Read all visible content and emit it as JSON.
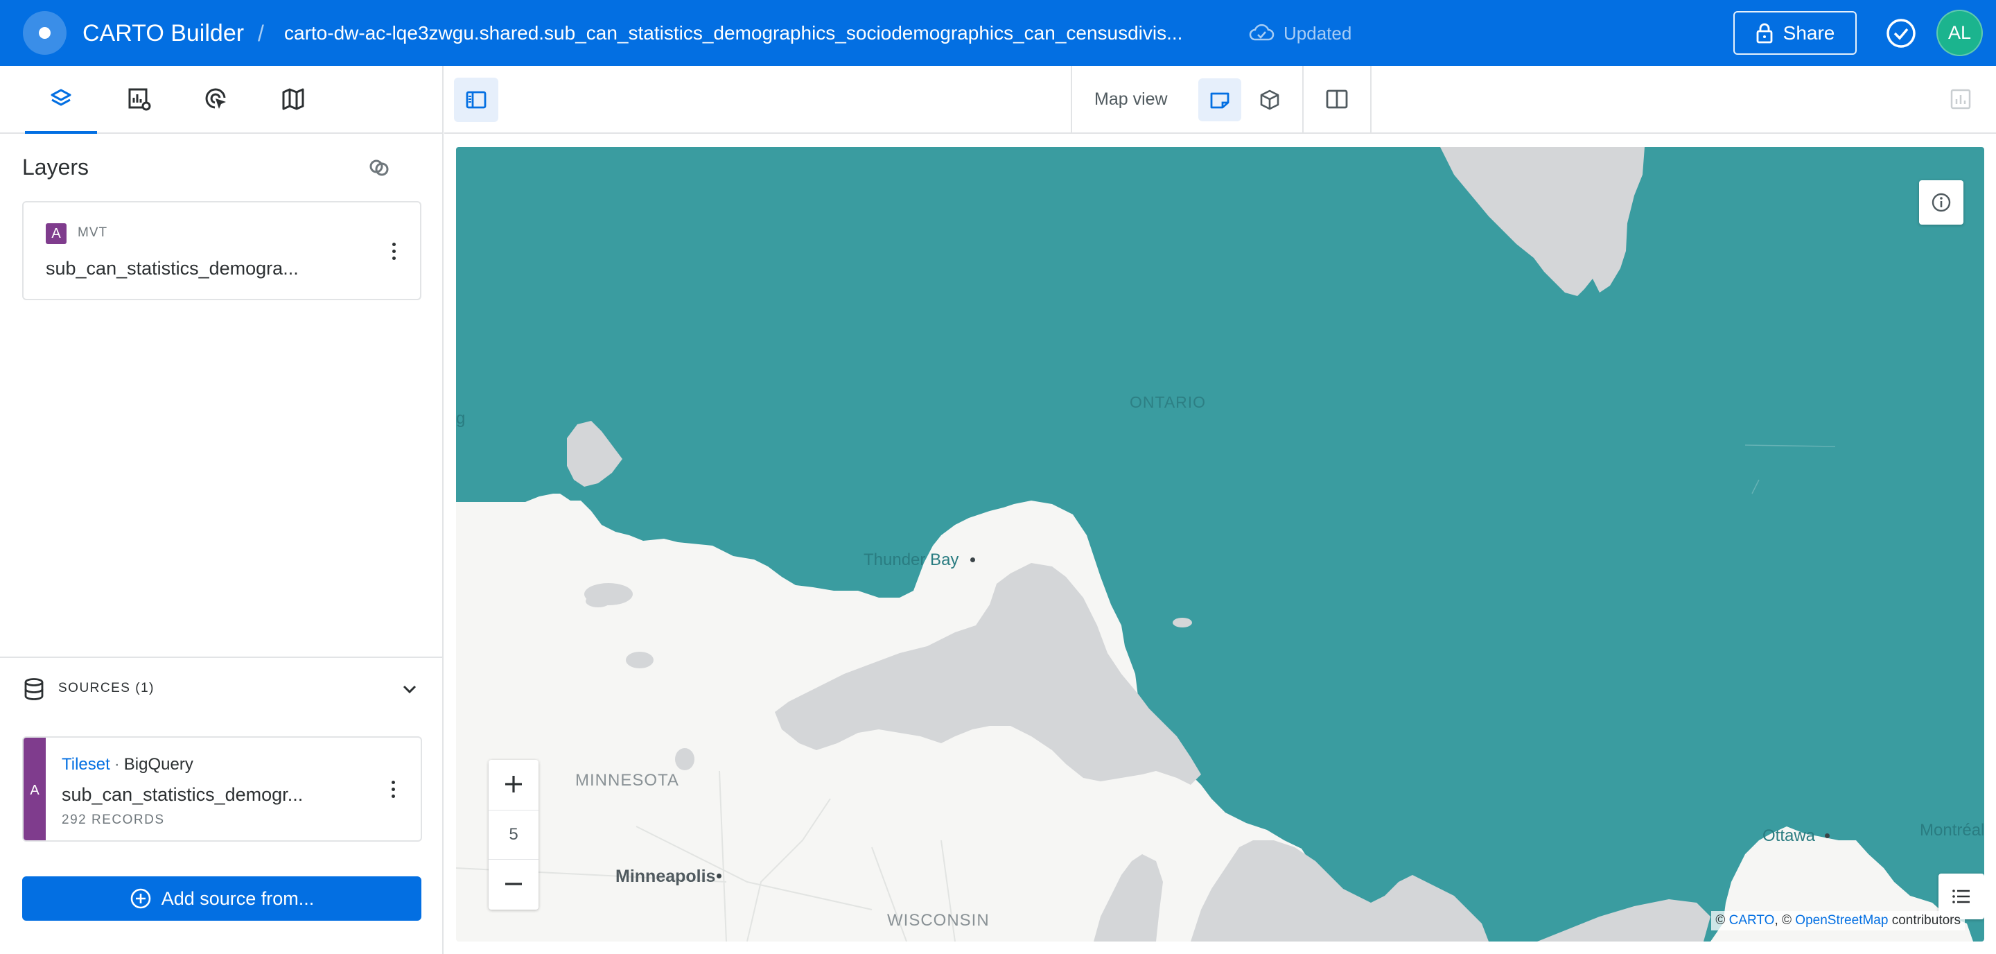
{
  "header": {
    "app_name": "CARTO Builder",
    "separator": "/",
    "map_title": "carto-dw-ac-lqe3zwgu.shared.sub_can_statistics_demographics_sociodemographics_can_censusdivis...",
    "status": "Updated",
    "share_label": "Share",
    "avatar_initials": "AL",
    "accent_color": "#036fe2"
  },
  "left_panel": {
    "tabs": [
      {
        "icon": "layers-icon",
        "active": true
      },
      {
        "icon": "widgets-settings-icon",
        "active": false
      },
      {
        "icon": "interactions-icon",
        "active": false
      },
      {
        "icon": "basemap-icon",
        "active": false
      }
    ],
    "layers_title": "Layers",
    "layer": {
      "badge": "A",
      "type": "MVT",
      "name": "sub_can_statistics_demogra...",
      "color": "#7f3c8d"
    },
    "sources_label": "SOURCES (1)",
    "source": {
      "badge": "A",
      "kind": "Tileset",
      "provider": "BigQuery",
      "name": "sub_can_statistics_demogr...",
      "records": "292 RECORDS"
    },
    "add_source_label": "Add source from..."
  },
  "map_toolbar": {
    "view_label": "Map view",
    "modes": [
      "2d-view-icon",
      "3d-view-icon",
      "split-view-icon"
    ]
  },
  "map": {
    "zoom_level": "5",
    "fill_color": "#3a9ca0",
    "land_color": "#f6f6f4",
    "water_color": "#d4d6d8",
    "labels": {
      "ontario": "ONTARIO",
      "minnesota": "MINNESOTA",
      "wisconsin": "WISCONSIN",
      "thunder_bay": "Thunder Bay",
      "minneapolis": "Minneapolis",
      "ottawa": "Ottawa",
      "montreal": "Montréal",
      "edge_city": "g"
    },
    "attribution": {
      "carto": "CARTO",
      "osm": "OpenStreetMap",
      "suffix": "contributors",
      "copyright": "©"
    }
  }
}
